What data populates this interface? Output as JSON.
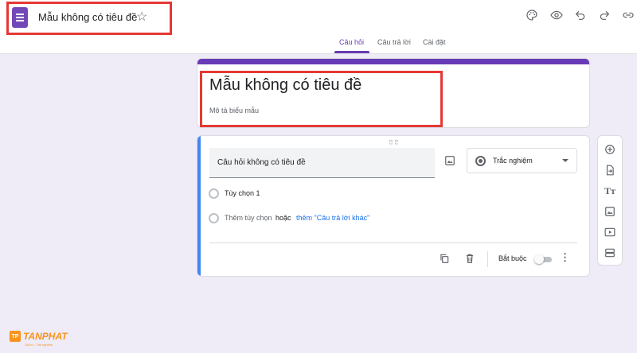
{
  "header": {
    "doc_title": "Mẫu không có tiêu đề",
    "star_icon": "star-outline-icon",
    "tools": [
      "palette-icon",
      "eye-icon",
      "undo-icon",
      "redo-icon",
      "link-icon"
    ]
  },
  "tabs": [
    {
      "label": "Câu hỏi",
      "active": true
    },
    {
      "label": "Câu trả lời",
      "active": false
    },
    {
      "label": "Cài đặt",
      "active": false
    }
  ],
  "form": {
    "title": "Mẫu không có tiêu đề",
    "description_placeholder": "Mô tả biểu mẫu"
  },
  "question": {
    "title_placeholder": "Câu hỏi không có tiêu đề",
    "type": "Trắc nghiệm",
    "option1": "Tùy chọn 1",
    "add_option": "Thêm tùy chọn",
    "or_label": "hoặc",
    "add_other": "thêm \"Câu trả lời khác\"",
    "required_label": "Bắt buộc",
    "required": false
  },
  "side_toolbar": [
    "add-question-icon",
    "import-questions-icon",
    "add-title-icon",
    "add-image-icon",
    "add-video-icon",
    "add-section-icon"
  ],
  "watermark": {
    "brand": "TANPHAT",
    "mark": "TP",
    "tagline": "Giá trị - Trải nghiệm"
  },
  "colors": {
    "accent": "#673ab7",
    "background": "#efebf7",
    "highlight_border": "#e53935",
    "question_accent": "#4285f4",
    "link": "#1a73e8",
    "brand": "#f7941d"
  }
}
